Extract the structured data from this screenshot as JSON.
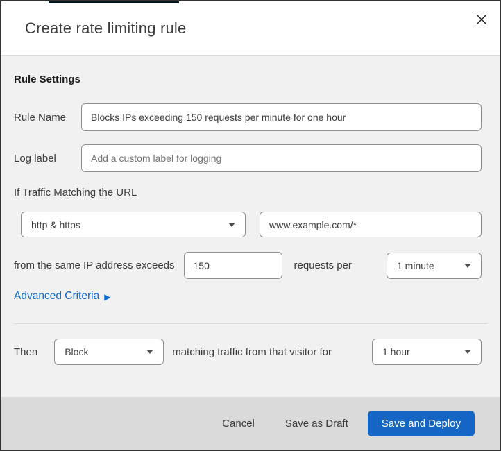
{
  "dialog": {
    "title": "Create rate limiting rule"
  },
  "rule_settings": {
    "heading": "Rule Settings",
    "rule_name": {
      "label": "Rule Name",
      "value": "Blocks IPs exceeding 150 requests per minute for one hour"
    },
    "log_label": {
      "label": "Log label",
      "placeholder": "Add a custom label for logging"
    },
    "traffic_match": {
      "intro": "If Traffic Matching the URL",
      "scheme_selected": "http & https",
      "url_value": "www.example.com/*"
    },
    "threshold": {
      "prefix": "from the same IP address exceeds",
      "requests_value": "150",
      "middle": "requests per",
      "period_selected": "1 minute"
    },
    "advanced_criteria": {
      "label": "Advanced Criteria",
      "arrow": "▶"
    }
  },
  "action": {
    "prefix": "Then",
    "action_selected": "Block",
    "middle": "matching traffic from that visitor for",
    "duration_selected": "1 hour"
  },
  "footer": {
    "cancel_label": "Cancel",
    "save_draft_label": "Save as Draft",
    "save_deploy_label": "Save and Deploy"
  },
  "colors": {
    "primary_button_blue": "#1565c4",
    "link_blue": "#0d6acb",
    "body_background": "#f1f1f2",
    "footer_background": "#dadada",
    "top_strip": "#02161f"
  }
}
